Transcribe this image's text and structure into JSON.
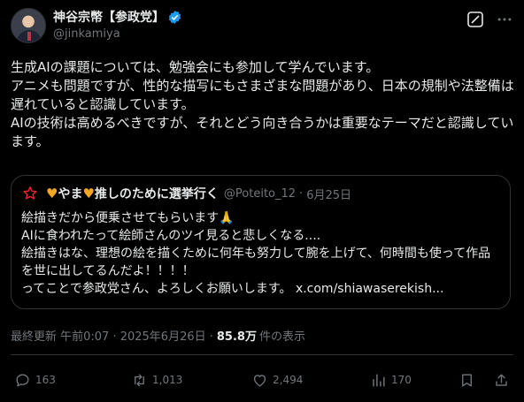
{
  "author": {
    "name": "神谷宗幣【参政党】",
    "handle": "@jinkamiya"
  },
  "post": {
    "text": "生成AIの課題については、勉強会にも参加して学んでいます。\nアニメも問題ですが、性的な描写にもさまざまな問題があり、日本の規制や法整備は遅れていると認識しています。\nAIの技術は高めるべきですが、それとどう向き合うかは重要なテーマだと認識しています。"
  },
  "quote": {
    "name_parts": [
      "やま",
      "推しのために選挙行く"
    ],
    "handle": "@Poteito_12",
    "separator": "·",
    "date": "6月25日",
    "text_lines": [
      "絵描きだから便乗させてもらいます🙏",
      "AIに食われたって絵師さんのツイ見ると悲しくなる....",
      "絵描きはな、理想の絵を描くために何年も努力して腕を上げて、何時間も使って作品を世に出してるんだよ！！！！",
      "ってことで参政党さん、よろしくお願いします。 "
    ],
    "link": "x.com/shiawaserekish..."
  },
  "meta": {
    "prefix": "最終更新 午前0:07 · 2025年6月26日 ·",
    "views": "85.8万",
    "suffix": "件の表示"
  },
  "actions": {
    "replies": "163",
    "reposts": "1,013",
    "likes": "2,494",
    "views": "170"
  },
  "colors": {
    "background": "#000000",
    "text": "#e7e9ea",
    "secondary": "#71767b",
    "border": "#2f3336",
    "verified": "#1d9bf0",
    "heart": "#f5a623",
    "star": "#f4212e"
  }
}
